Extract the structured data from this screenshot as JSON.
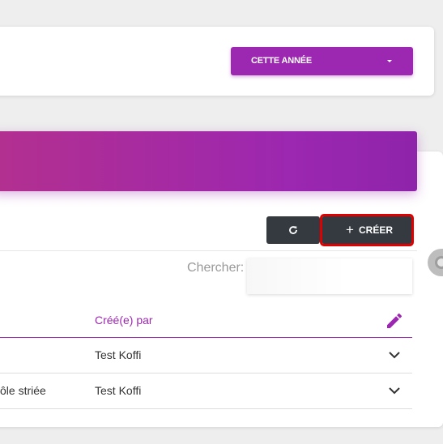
{
  "filter": {
    "period_label": "CETTE ANNÉE"
  },
  "toolbar": {
    "create_label": "CRÉER"
  },
  "search": {
    "label": "Chercher:",
    "value": ""
  },
  "table": {
    "header": {
      "created_by": "Créé(e) par"
    },
    "rows": [
      {
        "col1": "",
        "created_by": "Test Koffi"
      },
      {
        "col1": "ôle striée",
        "created_by": "Test Koffi"
      }
    ]
  },
  "colors": {
    "accent": "#9c27b0",
    "dark_button": "#343a40",
    "highlight": "#e00000"
  }
}
